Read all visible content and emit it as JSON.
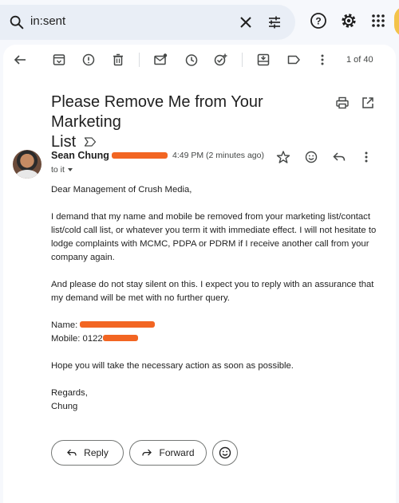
{
  "search": {
    "query": "in:sent"
  },
  "toolbar": {
    "page_count": "1 of 40"
  },
  "email": {
    "subject_line1": "Please Remove Me from Your Marketing",
    "subject_line2": "List",
    "sender_name": "Sean Chung",
    "time": "4:49 PM (2 minutes ago)",
    "to": "to it",
    "body": {
      "greeting": "Dear Management of Crush Media,",
      "para1": "I demand that my name and mobile be removed from your marketing list/contact list/cold call list, or whatever you term it with immediate effect. I will not hesitate to lodge complaints with MCMC, PDPA or PDRM if I receive another call from your company again.",
      "para2": "And please do not stay silent on this. I expect you to reply with an assurance that my demand will be met with no further query.",
      "name_label": "Name: ",
      "mobile_label": "Mobile: 0122",
      "closing_line": "Hope you will take the necessary action as soon as possible.",
      "regards": "Regards,",
      "signature": "Chung"
    }
  },
  "actions": {
    "reply": "Reply",
    "forward": "Forward"
  },
  "colors": {
    "redaction": "#f26522",
    "search_bg": "#e9eef6",
    "page_bg": "#f6f8fc"
  }
}
